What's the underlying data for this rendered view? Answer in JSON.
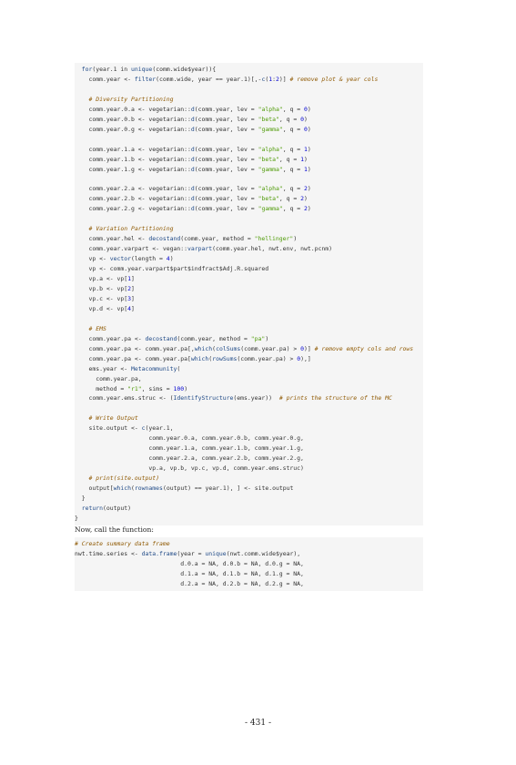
{
  "code_block_1": [
    "  for(year.1 in unique(comm.wide$year)){",
    "    comm.year <- filter(comm.wide, year == year.1)[,-c(1:2)] # remove plot & year cols",
    "",
    "    # Diversity Partitioning",
    "    comm.year.0.a <- vegetarian::d(comm.year, lev = \"alpha\", q = 0)",
    "    comm.year.0.b <- vegetarian::d(comm.year, lev = \"beta\", q = 0)",
    "    comm.year.0.g <- vegetarian::d(comm.year, lev = \"gamma\", q = 0)",
    "",
    "    comm.year.1.a <- vegetarian::d(comm.year, lev = \"alpha\", q = 1)",
    "    comm.year.1.b <- vegetarian::d(comm.year, lev = \"beta\", q = 1)",
    "    comm.year.1.g <- vegetarian::d(comm.year, lev = \"gamma\", q = 1)",
    "",
    "    comm.year.2.a <- vegetarian::d(comm.year, lev = \"alpha\", q = 2)",
    "    comm.year.2.b <- vegetarian::d(comm.year, lev = \"beta\", q = 2)",
    "    comm.year.2.g <- vegetarian::d(comm.year, lev = \"gamma\", q = 2)",
    "",
    "    # Variation Partitioning",
    "    comm.year.hel <- decostand(comm.year, method = \"hellinger\")",
    "    comm.year.varpart <- vegan::varpart(comm.year.hel, nwt.env, nwt.pcnm)",
    "    vp <- vector(length = 4)",
    "    vp <- comm.year.varpart$part$indfract$Adj.R.squared",
    "    vp.a <- vp[1]",
    "    vp.b <- vp[2]",
    "    vp.c <- vp[3]",
    "    vp.d <- vp[4]",
    "",
    "    # EMS",
    "    comm.year.pa <- decostand(comm.year, method = \"pa\")",
    "    comm.year.pa <- comm.year.pa[,which(colSums(comm.year.pa) > 0)] # remove empty cols and rows",
    "    comm.year.pa <- comm.year.pa[which(rowSums(comm.year.pa) > 0),]",
    "    ems.year <- Metacommunity(",
    "      comm.year.pa,",
    "      method = \"r1\", sims = 100)",
    "    comm.year.ems.struc <- (IdentifyStructure(ems.year))  # prints the structure of the MC",
    "",
    "    # Write Output",
    "    site.output <- c(year.1,",
    "                     comm.year.0.a, comm.year.0.b, comm.year.0.g,",
    "                     comm.year.1.a, comm.year.1.b, comm.year.1.g,",
    "                     comm.year.2.a, comm.year.2.b, comm.year.2.g,",
    "                     vp.a, vp.b, vp.c, vp.d, comm.year.ems.struc)",
    "    # print(site.output)",
    "    output[which(rownames(output) == year.1), ] <- site.output",
    "  }",
    "  return(output)",
    "}"
  ],
  "prose_text": "Now, call the function:",
  "code_block_2": [
    "# Create summary data frame",
    "nwt.time.series <- data.frame(year = unique(nwt.comm.wide$year),",
    "                              d.0.a = NA, d.0.b = NA, d.0.g = NA,",
    "                              d.1.a = NA, d.1.b = NA, d.1.g = NA,",
    "                              d.2.a = NA, d.2.b = NA, d.2.g = NA,"
  ],
  "page_number": "- 431 -"
}
